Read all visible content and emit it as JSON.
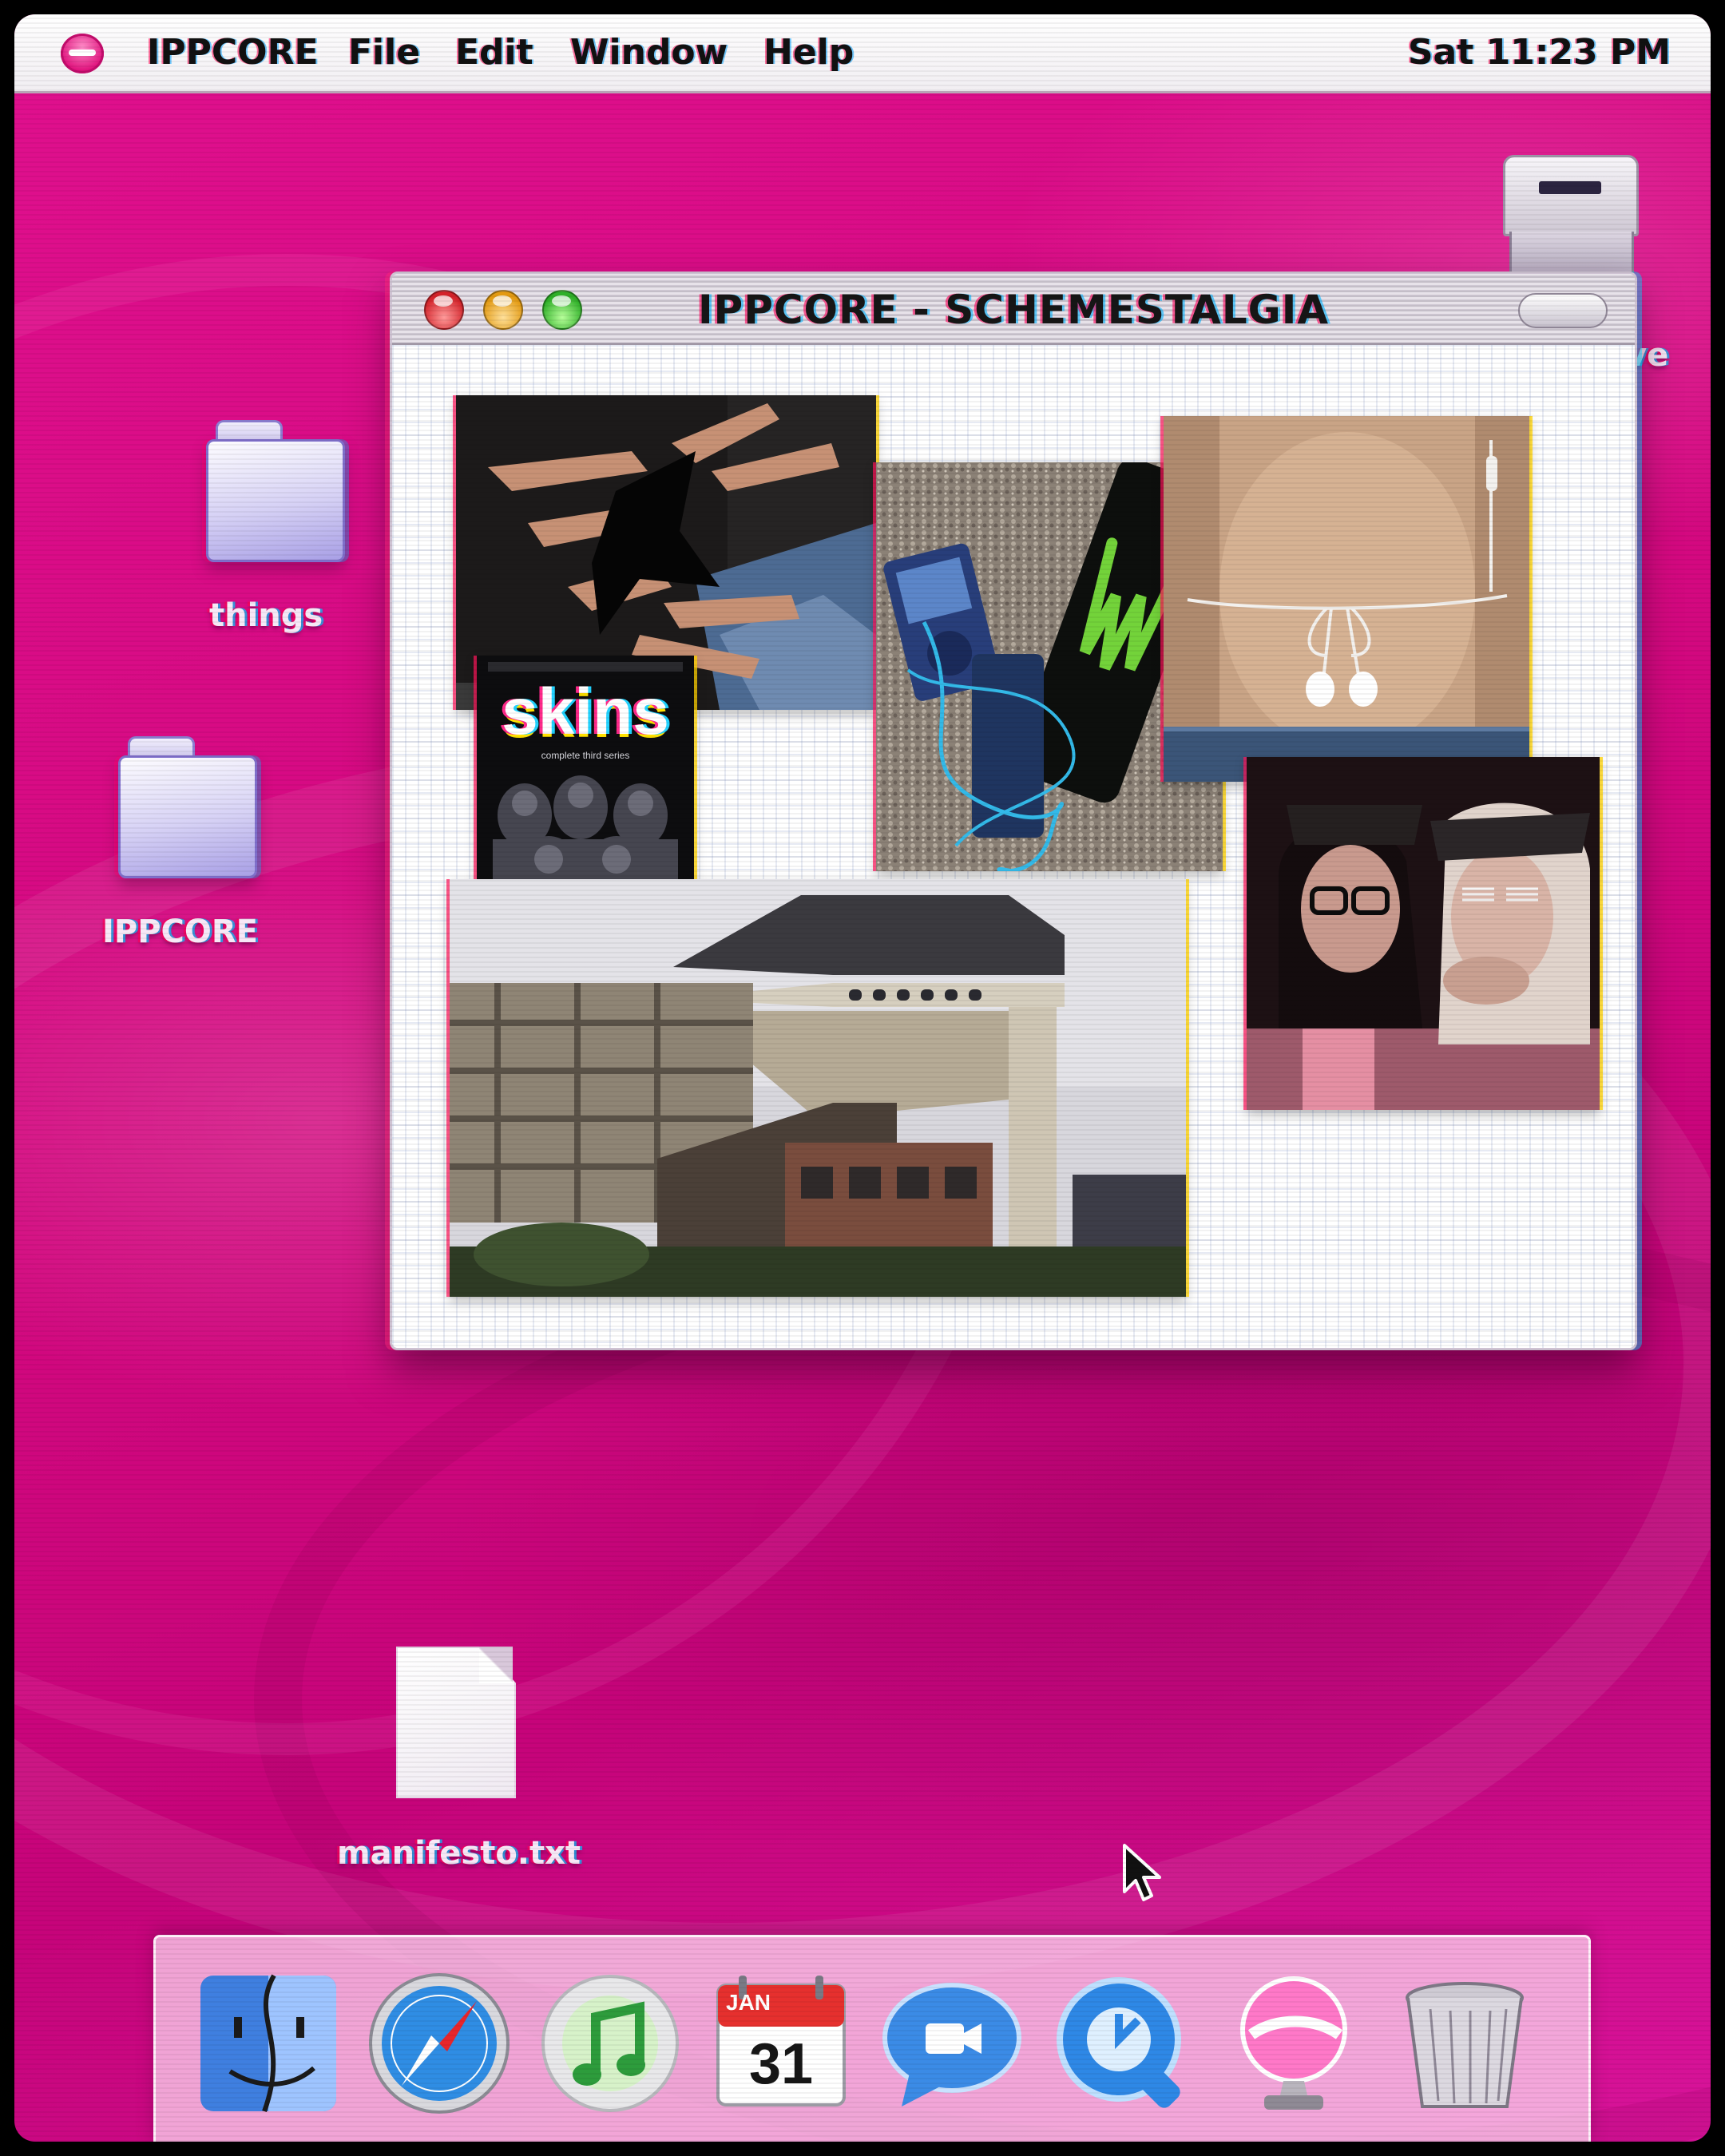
{
  "menubar": {
    "app_name": "IPPCORE",
    "menus": [
      "File",
      "Edit",
      "Window",
      "Help"
    ],
    "clock": "Sat 11:23 PM"
  },
  "desktop": {
    "icons": [
      {
        "label": "things",
        "type": "folder"
      },
      {
        "label": "IPPCORE",
        "type": "folder"
      },
      {
        "label": "manifesto.txt",
        "type": "document"
      },
      {
        "label": "ve",
        "type": "drive"
      }
    ]
  },
  "window": {
    "title": "IPPCORE - SCHEMESTALGIA",
    "collage": {
      "photos": [
        {
          "subject": "hands making star shape"
        },
        {
          "subject": "skins dvd cover",
          "text": "skins",
          "subtext": "complete third series"
        },
        {
          "subject": "ipod and energy drink can"
        },
        {
          "subject": "earphones on midriff"
        },
        {
          "subject": "school building"
        },
        {
          "subject": "two friends with hats and glasses"
        }
      ]
    }
  },
  "dock": {
    "items": [
      {
        "name": "Finder",
        "icon": "finder-icon"
      },
      {
        "name": "Safari",
        "icon": "safari-icon"
      },
      {
        "name": "iTunes",
        "icon": "itunes-icon"
      },
      {
        "name": "iCal",
        "icon": "calendar-icon",
        "month": "JAN",
        "day": "31"
      },
      {
        "name": "iChat",
        "icon": "ichat-icon"
      },
      {
        "name": "QuickTime",
        "icon": "quicktime-icon"
      },
      {
        "name": "Pink Globe",
        "icon": "globe-icon"
      },
      {
        "name": "Trash",
        "icon": "trash-icon"
      }
    ]
  },
  "colors": {
    "desktop_bg": "#d60a85",
    "menubar_bg": "#ffffff",
    "window_bg": "#ffffff",
    "accent": "#e0107c"
  }
}
